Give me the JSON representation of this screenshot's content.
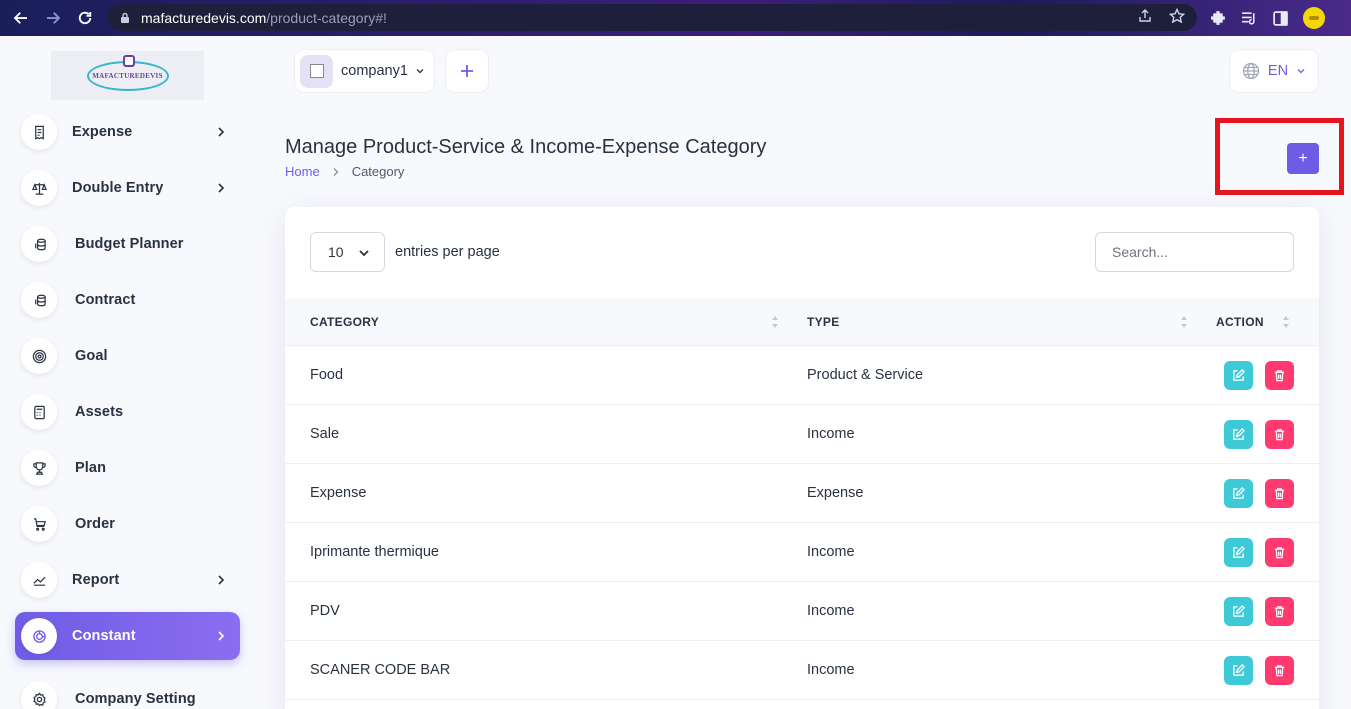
{
  "browser": {
    "url_domain": "mafacturedevis.com",
    "url_path": "/product-category#!"
  },
  "logo": {
    "text": "MAFACTUREDEVIS"
  },
  "sidebar": {
    "items": [
      {
        "label": "Expense",
        "icon": "receipt-icon",
        "has_submenu": true
      },
      {
        "label": "Double Entry",
        "icon": "balance-scale-icon",
        "has_submenu": true
      },
      {
        "label": "Budget Planner",
        "icon": "coins-icon",
        "has_submenu": false
      },
      {
        "label": "Contract",
        "icon": "coins-icon",
        "has_submenu": false
      },
      {
        "label": "Goal",
        "icon": "target-icon",
        "has_submenu": false
      },
      {
        "label": "Assets",
        "icon": "calculator-icon",
        "has_submenu": false
      },
      {
        "label": "Plan",
        "icon": "trophy-icon",
        "has_submenu": false
      },
      {
        "label": "Order",
        "icon": "cart-icon",
        "has_submenu": false
      },
      {
        "label": "Report",
        "icon": "chart-line-icon",
        "has_submenu": true
      },
      {
        "label": "Constant",
        "icon": "settings-spiral-icon",
        "has_submenu": true,
        "active": true
      },
      {
        "label": "Company Setting",
        "icon": "gear-icon",
        "has_submenu": false
      }
    ]
  },
  "topbar": {
    "company_name": "company1",
    "language": "EN"
  },
  "header": {
    "title": "Manage Product-Service & Income-Expense Category",
    "breadcrumb_home": "Home",
    "breadcrumb_current": "Category",
    "create_label": "+"
  },
  "table": {
    "entries_value": "10",
    "entries_label": "entries per page",
    "search_placeholder": "Search...",
    "columns": [
      "CATEGORY",
      "TYPE",
      "ACTION"
    ],
    "rows": [
      {
        "category": "Food",
        "type": "Product & Service"
      },
      {
        "category": "Sale",
        "type": "Income"
      },
      {
        "category": "Expense",
        "type": "Expense"
      },
      {
        "category": "Iprimante thermique",
        "type": "Income"
      },
      {
        "category": "PDV",
        "type": "Income"
      },
      {
        "category": "SCANER CODE BAR",
        "type": "Income"
      }
    ]
  },
  "colors": {
    "primary": "#6f5ce6",
    "edit": "#3ec9d6",
    "delete": "#ff3a6e",
    "highlight": "#e5141d"
  }
}
